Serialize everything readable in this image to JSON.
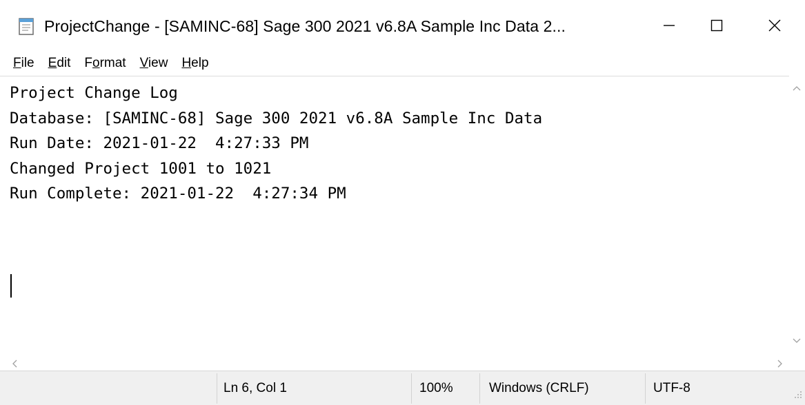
{
  "window": {
    "title": "ProjectChange - [SAMINC-68] Sage 300 2021 v6.8A Sample Inc Data 2...",
    "app_icon": "notepad-icon",
    "controls": {
      "minimize_icon": "minimize-icon",
      "maximize_icon": "maximize-icon",
      "close_icon": "close-icon"
    }
  },
  "menu": {
    "items": [
      {
        "label_pre": "",
        "accel": "F",
        "label_post": "ile"
      },
      {
        "label_pre": "",
        "accel": "E",
        "label_post": "dit"
      },
      {
        "label_pre": "F",
        "accel": "o",
        "label_post": "rmat"
      },
      {
        "label_pre": "",
        "accel": "V",
        "label_post": "iew"
      },
      {
        "label_pre": "",
        "accel": "H",
        "label_post": "elp"
      }
    ]
  },
  "document": {
    "lines": [
      "Project Change Log",
      "Database: [SAMINC-68] Sage 300 2021 v6.8A Sample Inc Data",
      "Run Date: 2021-01-22  4:27:33 PM",
      "Changed Project 1001 to 1021",
      "Run Complete: 2021-01-22  4:27:34 PM",
      ""
    ]
  },
  "statusbar": {
    "position": "Ln 6, Col 1",
    "zoom": "100%",
    "line_ending": "Windows (CRLF)",
    "encoding": "UTF-8"
  },
  "colors": {
    "statusbar_bg": "#f0f0f0",
    "scroll_arrow": "#a0a0a0"
  }
}
